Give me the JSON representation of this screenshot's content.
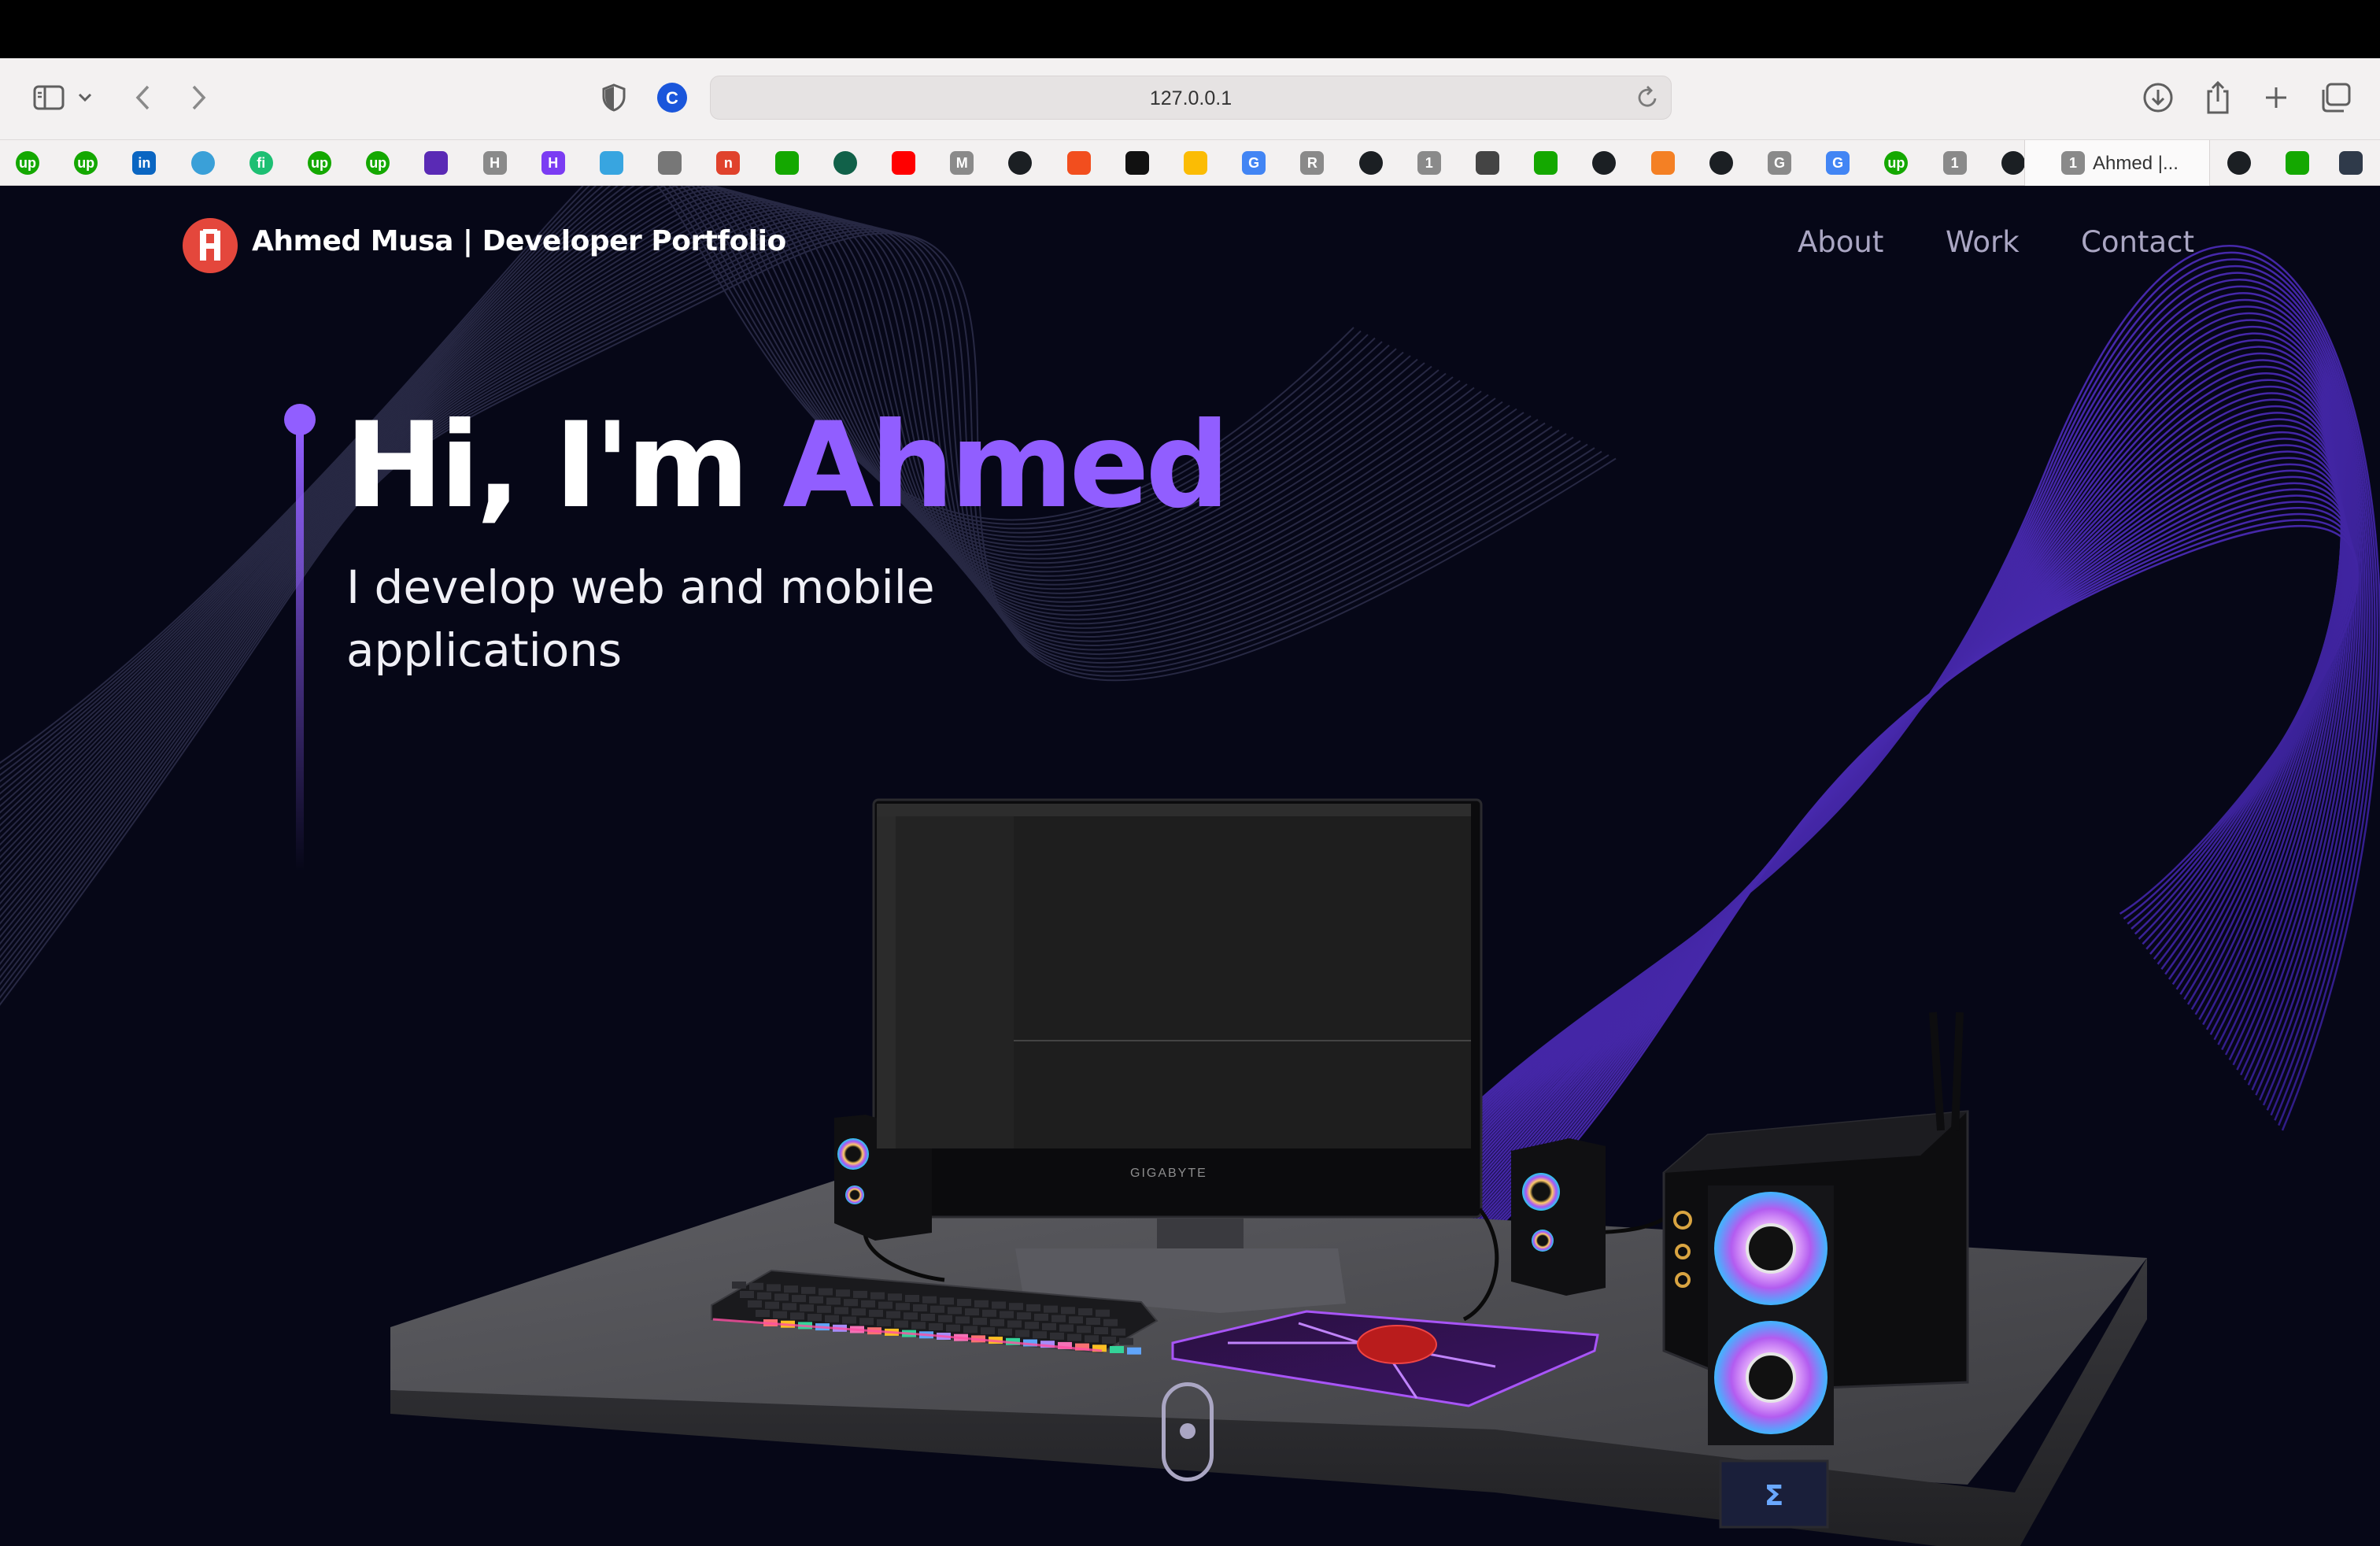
{
  "browser": {
    "url": "127.0.0.1",
    "tab_label": "Ahmed |...",
    "tab_badge": "1",
    "toolbar_icons": [
      "sidebar-icon",
      "chevron-down-icon",
      "back-icon",
      "forward-icon",
      "shield-icon",
      "download-icon",
      "share-icon",
      "new-tab-icon",
      "tab-overview-icon"
    ],
    "bookmarks": [
      {
        "icon": "upwork-icon",
        "text": "up",
        "color": "#14a800"
      },
      {
        "icon": "upwork-icon",
        "text": "up",
        "color": "#14a800"
      },
      {
        "icon": "linkedin-icon",
        "text": "in",
        "color": "#0a66c2"
      },
      {
        "icon": "bird-icon",
        "text": "",
        "color": "#3aa0d8"
      },
      {
        "icon": "fiverr-icon",
        "text": "fi",
        "color": "#1dbf73"
      },
      {
        "icon": "upwork-icon",
        "text": "up",
        "color": "#14a800"
      },
      {
        "icon": "upwork-icon",
        "text": "up",
        "color": "#14a800"
      },
      {
        "icon": "mail-icon",
        "text": "",
        "color": "#5a2ab5"
      },
      {
        "icon": "h-icon",
        "text": "H",
        "color": "#8a8a8a"
      },
      {
        "icon": "hotwire-icon",
        "text": "H",
        "color": "#7b3cf3"
      },
      {
        "icon": "wave-icon",
        "text": "",
        "color": "#38a5e0"
      },
      {
        "icon": "compass-icon",
        "text": "",
        "color": "#777777"
      },
      {
        "icon": "n-icon",
        "text": "n",
        "color": "#e0422c"
      },
      {
        "icon": "upwork-chart-icon",
        "text": "",
        "color": "#14a800"
      },
      {
        "icon": "leaf-icon",
        "text": "",
        "color": "#116149"
      },
      {
        "icon": "youtube-icon",
        "text": "",
        "color": "#ff0000"
      },
      {
        "icon": "m-icon",
        "text": "M",
        "color": "#8a8a8a"
      },
      {
        "icon": "github-icon",
        "text": "",
        "color": "#1b1f23"
      },
      {
        "icon": "figma-icon",
        "text": "",
        "color": "#f24e1e"
      },
      {
        "icon": "chip-icon",
        "text": "",
        "color": "#111111"
      },
      {
        "icon": "drive-icon",
        "text": "",
        "color": "#fbbc04"
      },
      {
        "icon": "google-icon",
        "text": "G",
        "color": "#4285f4"
      },
      {
        "icon": "r-icon",
        "text": "R",
        "color": "#8a8a8a"
      },
      {
        "icon": "github-icon",
        "text": "",
        "color": "#1b1f23"
      },
      {
        "icon": "one-icon",
        "text": "1",
        "color": "#8a8a8a"
      },
      {
        "icon": "pyramid-icon",
        "text": "",
        "color": "#444444"
      },
      {
        "icon": "upwork-chart-icon",
        "text": "",
        "color": "#14a800"
      },
      {
        "icon": "github-icon",
        "text": "",
        "color": "#1b1f23"
      },
      {
        "icon": "stackoverflow-icon",
        "text": "",
        "color": "#f48024"
      },
      {
        "icon": "github-icon",
        "text": "",
        "color": "#1b1f23"
      },
      {
        "icon": "g-icon",
        "text": "G",
        "color": "#8a8a8a"
      },
      {
        "icon": "google-icon",
        "text": "G",
        "color": "#4285f4"
      },
      {
        "icon": "upwork-icon",
        "text": "up",
        "color": "#14a800"
      },
      {
        "icon": "one-icon",
        "text": "1",
        "color": "#8a8a8a"
      },
      {
        "icon": "github-icon",
        "text": "",
        "color": "#1b1f23"
      }
    ],
    "tail_bookmarks": [
      {
        "icon": "github-icon",
        "text": "",
        "color": "#1b1f23"
      },
      {
        "icon": "upwork-chart-icon",
        "text": "",
        "color": "#14a800"
      },
      {
        "icon": "react-icon",
        "text": "",
        "color": "#2f3a4a"
      }
    ]
  },
  "site": {
    "brand": "Ahmed Musa  | Developer Portfolio",
    "nav": [
      "About",
      "Work",
      "Contact"
    ],
    "hero": {
      "greeting": "Hi, I'm ",
      "name": "Ahmed",
      "subtitle": "I develop web and mobile applications"
    },
    "monitor_brand": "GIGABYTE",
    "colors": {
      "accent": "#915eff",
      "background": "#060717",
      "nav_text": "#aaa6c3",
      "logo": "#e4473c"
    }
  }
}
